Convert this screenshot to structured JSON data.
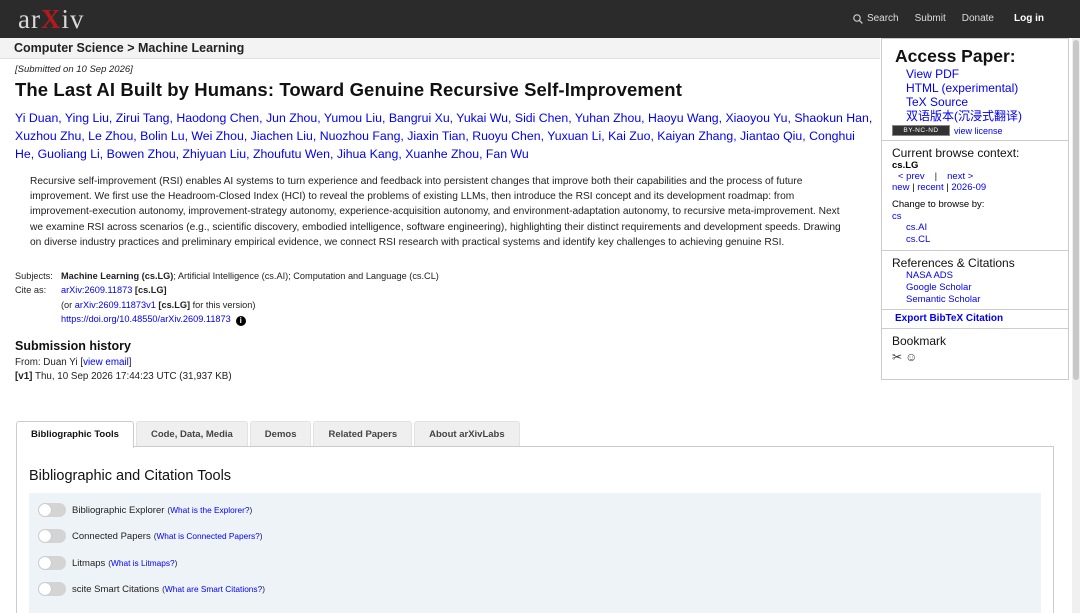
{
  "nav": {
    "logo_left": "ar",
    "logo_x": "X",
    "logo_right": "iv",
    "search": "Search",
    "submit": "Submit",
    "donate": "Donate",
    "login": "Log in"
  },
  "breadcrumb": "Computer Science > Machine Learning",
  "paper": {
    "submitted": "[Submitted on 10 Sep 2026]",
    "title": "The Last AI Built by Humans: Toward Genuine Recursive Self-Improvement",
    "authors": [
      "Yi Duan",
      "Ying Liu",
      "Zirui Tang",
      "Haodong Chen",
      "Jun Zhou",
      "Yumou Liu",
      "Bangrui Xu",
      "Yukai Wu",
      "Sidi Chen",
      "Yuhan Zhou",
      "Haoyu Wang",
      "Xiaoyou Yu",
      "Shaokun Han",
      "Xuzhou Zhu",
      "Le Zhou",
      "Bolin Lu",
      "Wei Zhou",
      "Jiachen Liu",
      "Nuozhou Fang",
      "Jiaxin Tian",
      "Ruoyu Chen",
      "Yuxuan Li",
      "Kai Zuo",
      "Kaiyan Zhang",
      "Jiantao Qiu",
      "Conghui He",
      "Guoliang Li",
      "Bowen Zhou",
      "Zhiyuan Liu",
      "Zhoufutu Wen",
      "Jihua Kang",
      "Xuanhe Zhou",
      "Fan Wu"
    ],
    "abstract": "Recursive self-improvement (RSI) enables AI systems to turn experience and feedback into persistent changes that improve both their capabilities and the process of future improvement. We first use the Headroom-Closed Index (HCI) to reveal the problems of existing LLMs, then introduce the RSI concept and its development roadmap: from improvement-execution autonomy, improvement-strategy autonomy, experience-acquisition autonomy, and environment-adaptation autonomy, to recursive meta-improvement. Next we examine RSI across scenarios (e.g., scientific discovery, embodied intelligence, software engineering), highlighting their distinct requirements and development speeds. Drawing on diverse industry practices and preliminary empirical evidence, we connect RSI research with practical systems and identify key challenges to achieving genuine RSI."
  },
  "meta": {
    "subjects_label": "Subjects:",
    "subjects_primary": "Machine Learning (cs.LG)",
    "subjects_rest": "; Artificial Intelligence (cs.AI); Computation and Language (cs.CL)",
    "cite_label": "Cite as:",
    "cite_id": "arXiv:2609.11873",
    "cite_tag": "[cs.LG]",
    "or_prefix": "(or",
    "cite_v1": "arXiv:2609.11873v1",
    "cite_v1_tag": "[cs.LG]",
    "or_suffix": "for this version)",
    "doi": "https://doi.org/10.48550/arXiv.2609.11873"
  },
  "history": {
    "heading": "Submission history",
    "from_prefix": "From: Duan Yi [",
    "view_email": "view email",
    "from_suffix": "]",
    "version": "[v1]",
    "date": "Thu, 10 Sep 2026 17:44:23 UTC (31,937 KB)"
  },
  "sidebar": {
    "access_heading": "Access Paper:",
    "access_links": [
      "View PDF",
      "HTML (experimental)",
      "TeX Source",
      "双语版本(沉浸式翻译)"
    ],
    "license_badge": "BY-NC-ND",
    "view_license": "view license",
    "context_heading": "Current browse context:",
    "context": "cs.LG",
    "prev": "< prev",
    "pipe": "|",
    "next": "next >",
    "new": "new",
    "recent": "recent",
    "month": "2026-09",
    "change_label": "Change to browse by:",
    "browse_cs": "cs",
    "browse_ai": "cs.AI",
    "browse_cl": "cs.CL",
    "refs_heading": "References & Citations",
    "refs": [
      "NASA ADS",
      "Google Scholar",
      "Semantic Scholar"
    ],
    "bibtex": "Export BibTeX Citation",
    "bookmark_heading": "Bookmark"
  },
  "tabs": [
    "Bibliographic Tools",
    "Code, Data, Media",
    "Demos",
    "Related Papers",
    "About arXivLabs"
  ],
  "panel": {
    "heading": "Bibliographic and Citation Tools",
    "tools": [
      {
        "name": "Bibliographic Explorer",
        "help": "What is the Explorer?"
      },
      {
        "name": "Connected Papers",
        "help": "What is Connected Papers?"
      },
      {
        "name": "Litmaps",
        "help": "What is Litmaps?"
      },
      {
        "name": "scite Smart Citations",
        "help": "What are Smart Citations?"
      }
    ]
  }
}
